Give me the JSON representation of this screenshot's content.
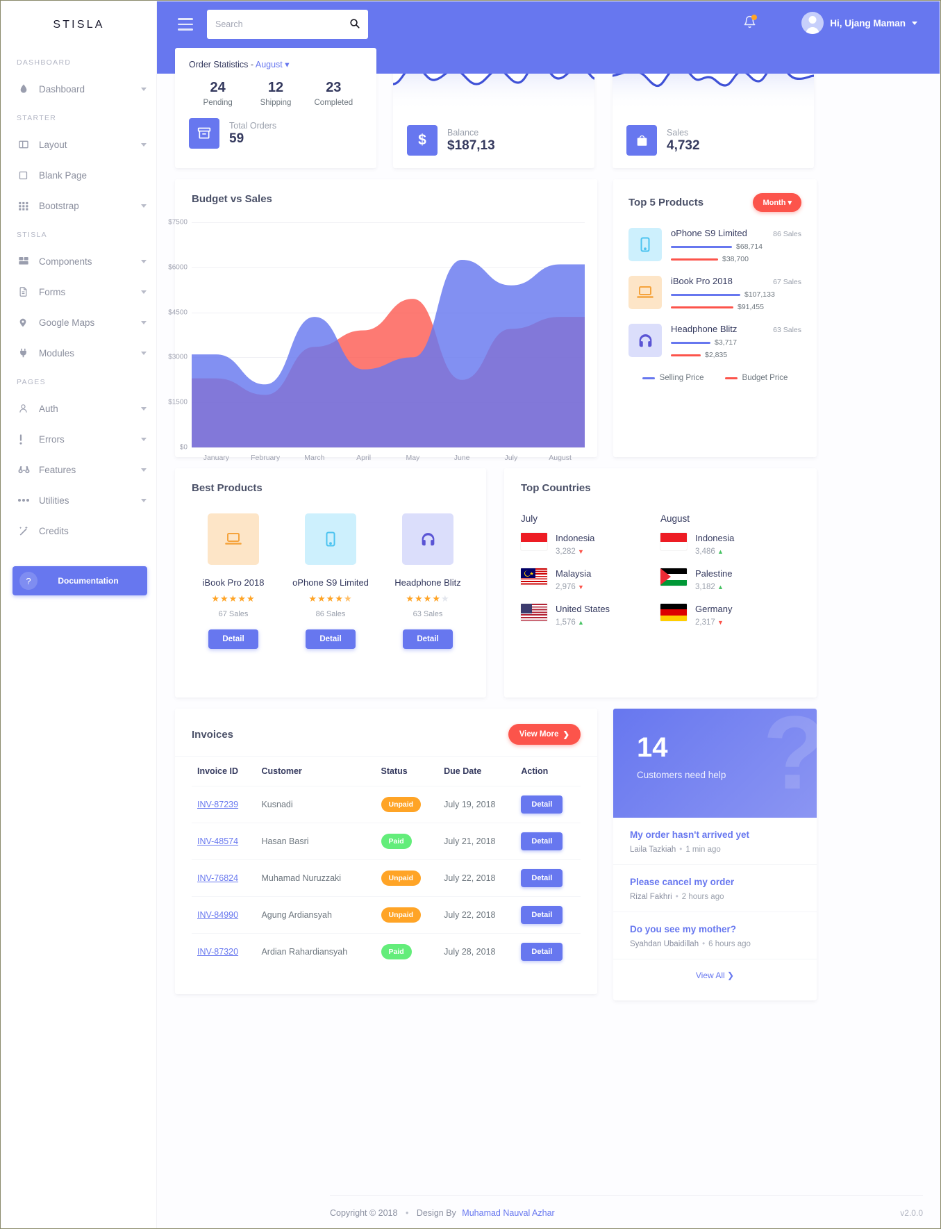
{
  "brand": {
    "name": "STISLA"
  },
  "sidebar": {
    "sections": [
      {
        "label": "DASHBOARD",
        "items": [
          {
            "label": "Dashboard",
            "icon": "droplet-icon",
            "caret": true
          }
        ]
      },
      {
        "label": "STARTER",
        "items": [
          {
            "label": "Layout",
            "icon": "layout-icon",
            "caret": true
          },
          {
            "label": "Blank Page",
            "icon": "square-icon",
            "caret": false
          },
          {
            "label": "Bootstrap",
            "icon": "grid-icon",
            "caret": true
          }
        ]
      },
      {
        "label": "STISLA",
        "items": [
          {
            "label": "Components",
            "icon": "components-icon",
            "caret": true
          },
          {
            "label": "Forms",
            "icon": "file-icon",
            "caret": true
          },
          {
            "label": "Google Maps",
            "icon": "map-pin-icon",
            "caret": true
          },
          {
            "label": "Modules",
            "icon": "plug-icon",
            "caret": true
          }
        ]
      },
      {
        "label": "PAGES",
        "items": [
          {
            "label": "Auth",
            "icon": "user-icon",
            "caret": true
          },
          {
            "label": "Errors",
            "icon": "exclamation-icon",
            "caret": true
          },
          {
            "label": "Features",
            "icon": "binoculars-icon",
            "caret": true
          },
          {
            "label": "Utilities",
            "icon": "ellipsis-icon",
            "caret": true
          },
          {
            "label": "Credits",
            "icon": "wand-icon",
            "caret": false
          }
        ]
      }
    ],
    "documentation_button": "Documentation"
  },
  "topbar": {
    "search_placeholder": "Search",
    "search_value": "",
    "user_greeting": "Hi, Ujang Maman",
    "has_notification": true
  },
  "order_statistics": {
    "title_prefix": "Order Statistics - ",
    "month": "August",
    "stats": [
      {
        "value": "24",
        "label": "Pending"
      },
      {
        "value": "12",
        "label": "Shipping"
      },
      {
        "value": "23",
        "label": "Completed"
      }
    ],
    "total_label": "Total Orders",
    "total_value": "59"
  },
  "kpi_cards": [
    {
      "label": "Balance",
      "value": "$187,13",
      "icon": "dollar-icon"
    },
    {
      "label": "Sales",
      "value": "4,732",
      "icon": "bag-icon"
    }
  ],
  "chart_data": {
    "type": "area",
    "title": "Budget vs Sales",
    "xlabel": "",
    "ylabel": "",
    "categories": [
      "January",
      "February",
      "March",
      "April",
      "May",
      "June",
      "July",
      "August"
    ],
    "ytick_labels": [
      "$0",
      "$1500",
      "$3000",
      "$4500",
      "$6000",
      "$7500"
    ],
    "ylim": [
      0,
      7500
    ],
    "grid": true,
    "legend": "none",
    "series": [
      {
        "name": "Sales",
        "color": "#6777ef",
        "values": [
          3100,
          2100,
          4350,
          2600,
          3000,
          6250,
          5400,
          6100
        ]
      },
      {
        "name": "Budget",
        "color": "#fc544b",
        "values": [
          2300,
          1750,
          3350,
          3900,
          4950,
          2250,
          3950,
          4350
        ]
      }
    ]
  },
  "top_products": {
    "title": "Top 5 Products",
    "filter": "Month",
    "legend": [
      {
        "label": "Selling Price",
        "color": "#6777ef"
      },
      {
        "label": "Budget Price",
        "color": "#fc544b"
      }
    ],
    "items": [
      {
        "name": "oPhone S9 Limited",
        "sales": "86 Sales",
        "icon": "phone-icon",
        "bg": "#cdf0fd",
        "fg": "#4cc3f0",
        "selling": "$68,714",
        "budget": "$38,700",
        "sell_w": 88,
        "bud_w": 68
      },
      {
        "name": "iBook Pro 2018",
        "sales": "67 Sales",
        "icon": "laptop-icon",
        "bg": "#fde5c7",
        "fg": "#f5a33c",
        "selling": "$107,133",
        "budget": "$91,455",
        "sell_w": 100,
        "bud_w": 90
      },
      {
        "name": "Headphone Blitz",
        "sales": "63 Sales",
        "icon": "headphone-icon",
        "bg": "#dbdefb",
        "fg": "#5a54d4",
        "selling": "$3,717",
        "budget": "$2,835",
        "sell_w": 57,
        "bud_w": 43
      }
    ]
  },
  "best_products": {
    "title": "Best Products",
    "detail_label": "Detail",
    "items": [
      {
        "name": "iBook Pro 2018",
        "sales": "67 Sales",
        "stars": 5,
        "half": false,
        "icon": "laptop-icon",
        "bg": "#fde5c7",
        "fg": "#f5a33c"
      },
      {
        "name": "oPhone S9 Limited",
        "sales": "86 Sales",
        "stars": 4,
        "half": true,
        "icon": "phone-icon",
        "bg": "#cdf0fd",
        "fg": "#4cc3f0"
      },
      {
        "name": "Headphone Blitz",
        "sales": "63 Sales",
        "stars": 4,
        "half": false,
        "icon": "headphone-icon",
        "bg": "#dbdefb",
        "fg": "#5a54d4"
      }
    ]
  },
  "top_countries": {
    "title": "Top Countries",
    "columns": [
      {
        "month": "July",
        "rows": [
          {
            "country": "Indonesia",
            "value": "3,282",
            "trend": "down",
            "flag": "indonesia"
          },
          {
            "country": "Malaysia",
            "value": "2,976",
            "trend": "down",
            "flag": "malaysia"
          },
          {
            "country": "United States",
            "value": "1,576",
            "trend": "up",
            "flag": "usa"
          }
        ]
      },
      {
        "month": "August",
        "rows": [
          {
            "country": "Indonesia",
            "value": "3,486",
            "trend": "up",
            "flag": "indonesia"
          },
          {
            "country": "Palestine",
            "value": "3,182",
            "trend": "up",
            "flag": "palestine"
          },
          {
            "country": "Germany",
            "value": "2,317",
            "trend": "down",
            "flag": "germany"
          }
        ]
      }
    ]
  },
  "invoices": {
    "title": "Invoices",
    "view_more": "View More",
    "headers": [
      "Invoice ID",
      "Customer",
      "Status",
      "Due Date",
      "Action"
    ],
    "action_label": "Detail",
    "rows": [
      {
        "id": "INV-87239",
        "customer": "Kusnadi",
        "status": "Unpaid",
        "due": "July 19, 2018"
      },
      {
        "id": "INV-48574",
        "customer": "Hasan Basri",
        "status": "Paid",
        "due": "July 21, 2018"
      },
      {
        "id": "INV-76824",
        "customer": "Muhamad Nuruzzaki",
        "status": "Unpaid",
        "due": "July 22, 2018"
      },
      {
        "id": "INV-84990",
        "customer": "Agung Ardiansyah",
        "status": "Unpaid",
        "due": "July 22, 2018"
      },
      {
        "id": "INV-87320",
        "customer": "Ardian Rahardiansyah",
        "status": "Paid",
        "due": "July 28, 2018"
      }
    ]
  },
  "support": {
    "count": "14",
    "caption": "Customers need help",
    "view_all": "View All",
    "messages": [
      {
        "title": "My order hasn't arrived yet",
        "author": "Laila Tazkiah",
        "time": "1 min ago"
      },
      {
        "title": "Please cancel my order",
        "author": "Rizal Fakhri",
        "time": "2 hours ago"
      },
      {
        "title": "Do you see my mother?",
        "author": "Syahdan Ubaidillah",
        "time": "6 hours ago"
      }
    ]
  },
  "footer": {
    "copyright": "Copyright © 2018",
    "sep": "•",
    "design_by": "Design By",
    "author": "Muhamad Nauval Azhar",
    "version": "v2.0.0"
  }
}
